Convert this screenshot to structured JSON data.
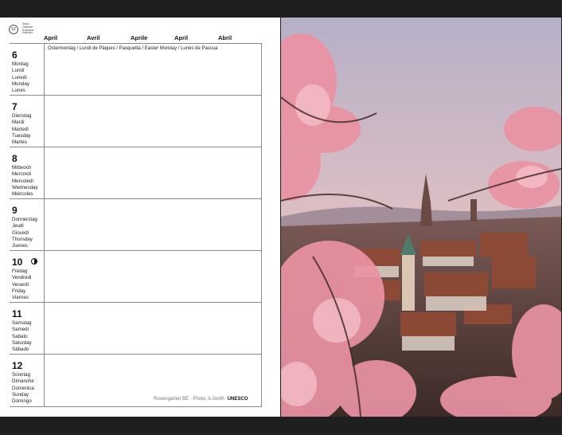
{
  "brand": {
    "logo_text": "52",
    "lines": "Swiss\nCalendar\nSchweizer\nKalender"
  },
  "months": [
    "April",
    "Avril",
    "Aprile",
    "April",
    "Abril"
  ],
  "days": [
    {
      "num": "6",
      "names": [
        "Montag",
        "Lundi",
        "Lunedì",
        "Monday",
        "Lunes"
      ],
      "note": "Ostermontag / Lundi de Pâques / Pasquetta / Easter Monday / Lunes de Pascua",
      "moon": false
    },
    {
      "num": "7",
      "names": [
        "Dienstag",
        "Mardi",
        "Martedì",
        "Tuesday",
        "Martes"
      ],
      "note": "",
      "moon": false
    },
    {
      "num": "8",
      "names": [
        "Mittwoch",
        "Mercredi",
        "Mercoledì",
        "Wednesday",
        "Miércoles"
      ],
      "note": "",
      "moon": false
    },
    {
      "num": "9",
      "names": [
        "Donnerstag",
        "Jeudi",
        "Giovedì",
        "Thursday",
        "Jueves"
      ],
      "note": "",
      "moon": false
    },
    {
      "num": "10",
      "names": [
        "Freitag",
        "Vendredi",
        "Venerdì",
        "Friday",
        "Viernes"
      ],
      "note": "",
      "moon": true
    },
    {
      "num": "11",
      "names": [
        "Samstag",
        "Samedi",
        "Sabato",
        "Saturday",
        "Sábado"
      ],
      "note": "",
      "moon": false
    },
    {
      "num": "12",
      "names": [
        "Sonntag",
        "Dimanche",
        "Domenica",
        "Sunday",
        "Domingo"
      ],
      "note": "",
      "moon": false
    }
  ],
  "caption": {
    "text": "Rosengarten BE · Photo: A.Gerth",
    "badge": "UNESCO"
  },
  "photo": {
    "sky_top": "#b9b3c9",
    "sky_glow": "#efb2a6",
    "blossom": "#e88e9e",
    "roofs": "#8d4d3c"
  }
}
